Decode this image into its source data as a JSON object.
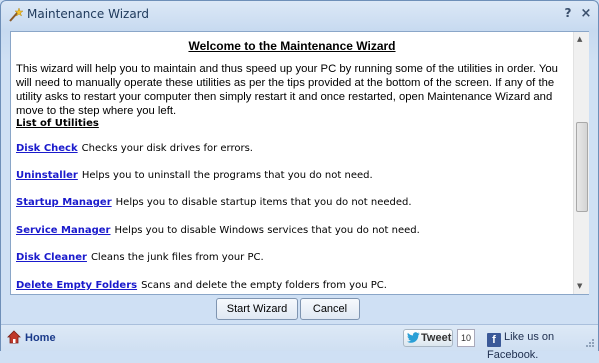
{
  "window": {
    "title": "Maintenance Wizard",
    "help_glyph": "?",
    "close_glyph": "×"
  },
  "content": {
    "heading": "Welcome to the Maintenance Wizard",
    "intro": "This wizard will help you to maintain and thus speed up your PC by running some of the utilities in order. You will need to manually operate these utilities as per the tips provided at the bottom of the screen. If any of the utility asks to restart your computer then simply restart it and once restarted, open Maintenance Wizard and move to the step where you left.",
    "list_title": "List of Utilities",
    "utilities": [
      {
        "name": "Disk Check",
        "desc": "Checks your disk drives for errors."
      },
      {
        "name": "Uninstaller",
        "desc": "Helps you to uninstall the programs that you do not need."
      },
      {
        "name": "Startup Manager",
        "desc": "Helps you to disable startup items that you do not needed."
      },
      {
        "name": "Service Manager",
        "desc": "Helps you to disable Windows services that you do not need."
      },
      {
        "name": "Disk Cleaner",
        "desc": "Cleans the junk files from your PC."
      },
      {
        "name": "Delete Empty Folders",
        "desc": "Scans and delete the empty folders from you PC."
      }
    ]
  },
  "buttons": {
    "start": "Start Wizard",
    "cancel": "Cancel"
  },
  "status": {
    "home": "Home",
    "tweet": "Tweet",
    "tweet_count": "10",
    "facebook": "Like us on Facebook."
  },
  "colors": {
    "link": "#1a1acc",
    "facebook": "#3b5998"
  },
  "icons": {
    "title": "wand-icon",
    "home": "home-icon",
    "twitter": "twitter-bird-icon",
    "facebook": "facebook-icon"
  }
}
